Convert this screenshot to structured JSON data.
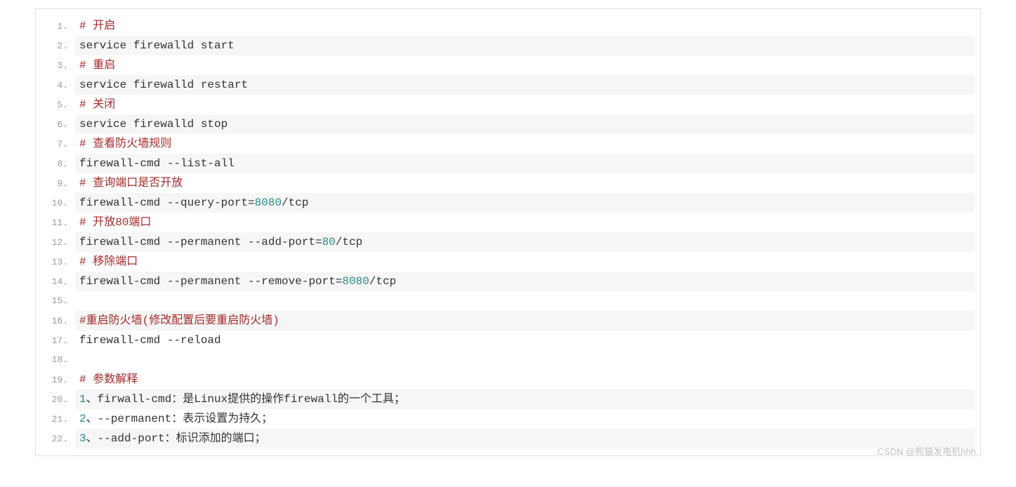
{
  "watermark": "CSDN @熊猫发电机hhh",
  "lines": [
    {
      "num": "1.",
      "tokens": [
        {
          "t": "comment",
          "v": "# 开启"
        }
      ]
    },
    {
      "num": "2.",
      "tokens": [
        {
          "t": "plain",
          "v": "service firewalld start"
        }
      ]
    },
    {
      "num": "3.",
      "tokens": [
        {
          "t": "comment",
          "v": "# 重启"
        }
      ]
    },
    {
      "num": "4.",
      "tokens": [
        {
          "t": "plain",
          "v": "service firewalld restart"
        }
      ]
    },
    {
      "num": "5.",
      "tokens": [
        {
          "t": "comment",
          "v": "# 关闭"
        }
      ]
    },
    {
      "num": "6.",
      "tokens": [
        {
          "t": "plain",
          "v": "service firewalld stop"
        }
      ]
    },
    {
      "num": "7.",
      "tokens": [
        {
          "t": "comment",
          "v": "# 查看防火墙规则"
        }
      ]
    },
    {
      "num": "8.",
      "tokens": [
        {
          "t": "plain",
          "v": "firewall-cmd --list-all"
        }
      ]
    },
    {
      "num": "9.",
      "tokens": [
        {
          "t": "comment",
          "v": "# 查询端口是否开放"
        }
      ]
    },
    {
      "num": "10.",
      "tokens": [
        {
          "t": "plain",
          "v": "firewall-cmd --query-port="
        },
        {
          "t": "num",
          "v": "8080"
        },
        {
          "t": "plain",
          "v": "/tcp"
        }
      ]
    },
    {
      "num": "11.",
      "tokens": [
        {
          "t": "comment",
          "v": "# 开放80端口"
        }
      ]
    },
    {
      "num": "12.",
      "tokens": [
        {
          "t": "plain",
          "v": "firewall-cmd --permanent --add-port="
        },
        {
          "t": "num",
          "v": "80"
        },
        {
          "t": "plain",
          "v": "/tcp"
        }
      ]
    },
    {
      "num": "13.",
      "tokens": [
        {
          "t": "comment",
          "v": "# 移除端口"
        }
      ]
    },
    {
      "num": "14.",
      "tokens": [
        {
          "t": "plain",
          "v": "firewall-cmd --permanent --remove-port="
        },
        {
          "t": "num",
          "v": "8080"
        },
        {
          "t": "plain",
          "v": "/tcp"
        }
      ]
    },
    {
      "num": "15.",
      "tokens": [
        {
          "t": "plain",
          "v": ""
        }
      ]
    },
    {
      "num": "16.",
      "tokens": [
        {
          "t": "comment",
          "v": "#重启防火墙(修改配置后要重启防火墙)"
        }
      ]
    },
    {
      "num": "17.",
      "tokens": [
        {
          "t": "plain",
          "v": "firewall-cmd --reload"
        }
      ]
    },
    {
      "num": "18.",
      "tokens": [
        {
          "t": "plain",
          "v": ""
        }
      ]
    },
    {
      "num": "19.",
      "tokens": [
        {
          "t": "comment",
          "v": "# 参数解释"
        }
      ]
    },
    {
      "num": "20.",
      "tokens": [
        {
          "t": "num",
          "v": "1"
        },
        {
          "t": "plain",
          "v": "、firwall-cmd：是Linux提供的操作firewall的一个工具；"
        }
      ]
    },
    {
      "num": "21.",
      "tokens": [
        {
          "t": "num",
          "v": "2"
        },
        {
          "t": "plain",
          "v": "、--permanent：表示设置为持久；"
        }
      ]
    },
    {
      "num": "22.",
      "tokens": [
        {
          "t": "num",
          "v": "3"
        },
        {
          "t": "plain",
          "v": "、--add-port：标识添加的端口；"
        }
      ]
    }
  ]
}
